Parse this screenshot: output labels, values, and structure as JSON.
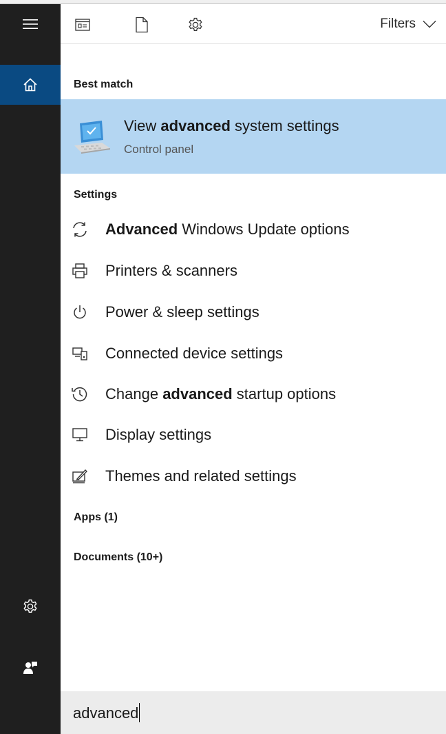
{
  "rail": {
    "items": [
      {
        "icon": "hamburger-menu-icon"
      },
      {
        "icon": "home-icon",
        "active": true
      },
      {
        "icon": "settings-gear-icon"
      },
      {
        "icon": "user-feedback-icon"
      }
    ]
  },
  "toolbar": {
    "icons": [
      "apps-filter-icon",
      "documents-filter-icon",
      "settings-filter-icon"
    ],
    "filters_label": "Filters"
  },
  "best_match": {
    "section_title": "Best match",
    "title_pre": "View ",
    "title_bold": "advanced",
    "title_post": " system settings",
    "subtitle": "Control panel",
    "highlight_color": "#b4d6f2"
  },
  "settings": {
    "section_title": "Settings",
    "items": [
      {
        "icon": "sync-icon",
        "pre": "",
        "bold": "Advanced",
        "post": " Windows Update options"
      },
      {
        "icon": "printer-icon",
        "pre": "Printers & scanners",
        "bold": "",
        "post": ""
      },
      {
        "icon": "power-icon",
        "pre": "Power & sleep settings",
        "bold": "",
        "post": ""
      },
      {
        "icon": "connected-devices-icon",
        "pre": "Connected device settings",
        "bold": "",
        "post": ""
      },
      {
        "icon": "history-icon",
        "pre": "Change ",
        "bold": "advanced",
        "post": " startup options"
      },
      {
        "icon": "monitor-icon",
        "pre": "Display settings",
        "bold": "",
        "post": ""
      },
      {
        "icon": "themes-icon",
        "pre": "Themes and related settings",
        "bold": "",
        "post": ""
      }
    ]
  },
  "apps": {
    "section_title": "Apps (1)"
  },
  "documents": {
    "section_title": "Documents (10+)"
  },
  "search": {
    "value": "advanced"
  },
  "colors": {
    "rail": "#1f1f1f",
    "rail_active": "#0a4a82",
    "search_bar": "#ececec"
  }
}
